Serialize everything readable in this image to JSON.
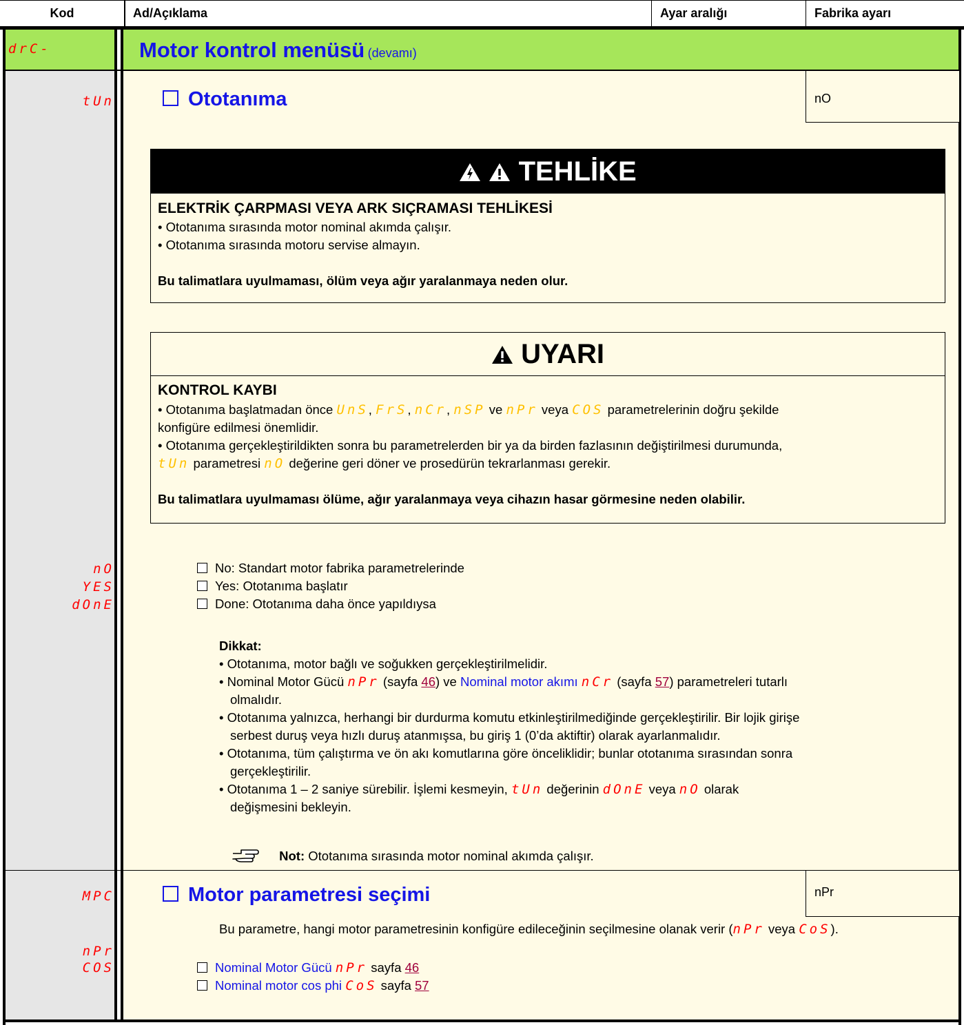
{
  "header": {
    "col_code": "Kod",
    "col_desc": "Ad/Açıklama",
    "col_range": "Ayar aralığı",
    "col_factory": "Fabrika ayarı"
  },
  "menu": {
    "code": "drC-",
    "title": "Motor kontrol menüsü",
    "subtitle": "(devamı)"
  },
  "tun": {
    "code": "tUn",
    "title": "Ototanıma",
    "factory": "nO",
    "danger": {
      "title": "TEHLİKE",
      "heading": "ELEKTRİK ÇARPMASI VEYA ARK SIÇRAMASI TEHLİKESİ",
      "items": [
        "• Ototanıma sırasında motor nominal akımda çalışır.",
        "• Ototanıma sırasında motoru servise almayın."
      ],
      "footer": "Bu talimatlara uyulmaması, ölüm veya ağır yaralanmaya neden olur."
    },
    "warning": {
      "title": "UYARI",
      "heading": "KONTROL KAYBI",
      "p1_a": "• Ototanıma başlatmadan önce",
      "code_uns": "UnS",
      "code_frs": "FrS",
      "code_ncr": "nCr",
      "code_nsp": "nSP",
      "ve": "ve",
      "code_npr": "nPr",
      "veya": "veya",
      "code_cos": "COS",
      "p1_b": "parametrelerinin doğru şekilde",
      "p1_c": "konfigüre edilmesi önemlidir.",
      "p2": "• Ototanıma gerçekleştirildikten sonra bu parametrelerden bir ya da birden fazlasının değiştirilmesi durumunda,",
      "p3_code": "tUn",
      "p3_a": "parametresi",
      "p3_code2": "nO",
      "p3_b": "değerine geri döner ve prosedürün tekrarlanması gerekir.",
      "footer": "Bu talimatlara uyulmaması ölüme, ağır yaralanmaya veya cihazın hasar görmesine neden olabilir."
    },
    "options": [
      {
        "code": "nO",
        "label": "No: Standart motor fabrika parametrelerinde"
      },
      {
        "code": "YES",
        "label": "Yes: Ototanıma başlatır"
      },
      {
        "code": "dOnE",
        "label": "Done: Ototanıma daha önce yapıldıysa"
      }
    ],
    "note_heading": "Dikkat:",
    "notes": {
      "n1": "• Ototanıma, motor bağlı ve soğukken gerçekleştirilmelidir.",
      "n2_a": "• Nominal Motor Gücü",
      "n2_code1": "nPr",
      "n2_b": "(sayfa",
      "n2_page1": "46",
      "n2_c": ") ve",
      "n2_link": "Nominal motor akımı",
      "n2_code2": "nCr",
      "n2_d": "(sayfa",
      "n2_page2": "57",
      "n2_e": ") parametreleri tutarlı",
      "n2_f": "olmalıdır.",
      "n3": "• Ototanıma yalnızca, herhangi bir durdurma komutu etkinleştirilmediğinde gerçekleştirilir. Bir lojik girişe",
      "n3b": "serbest duruş veya hızlı duruş atanmışsa, bu giriş 1 (0’da aktiftir) olarak ayarlanmalıdır.",
      "n4": "• Ototanıma, tüm çalıştırma ve ön akı komutlarına göre önceliklidir; bunlar ototanıma sırasından sonra",
      "n4b": "gerçekleştirilir.",
      "n5_a": "• Ototanıma 1 – 2 saniye sürebilir. İşlemi kesmeyin,",
      "n5_code1": "tUn",
      "n5_b": "değerinin",
      "n5_code2": "dOnE",
      "n5_c": "veya",
      "n5_code3": "nO",
      "n5_d": "olarak",
      "n5_e": "değişmesini bekleyin."
    },
    "tip_label": "Not:",
    "tip_text": "Ototanıma sırasında motor nominal akımda çalışır."
  },
  "mpc": {
    "code": "MPC",
    "title": "Motor parametresi seçimi",
    "factory": "nPr",
    "desc_a": "Bu parametre, hangi motor parametresinin konfigüre edileceğinin seçilmesine olanak verir (",
    "desc_code1": "nPr",
    "desc_veya": "veya",
    "desc_code2": "CoS",
    "desc_end": ").",
    "options": [
      {
        "code": "nPr",
        "label": "Nominal Motor Gücü",
        "inline_code": "nPr",
        "sayfa": "sayfa",
        "page": "46"
      },
      {
        "code": "COS",
        "label": "Nominal motor cos phi",
        "inline_code": "CoS",
        "sayfa": "sayfa",
        "page": "57"
      }
    ]
  }
}
